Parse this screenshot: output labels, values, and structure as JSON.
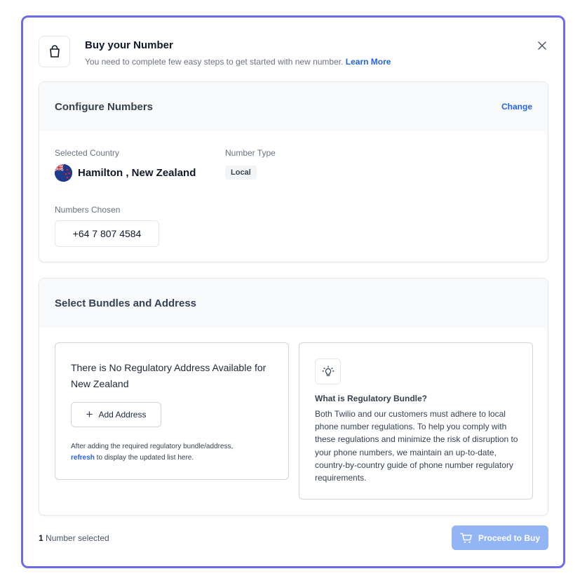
{
  "header": {
    "title": "Buy your Number",
    "subtitle": "You need to complete few easy steps to get started with new number.",
    "learn_more": "Learn More",
    "bag_icon": "shopping-bag-icon",
    "close_icon": "close-icon"
  },
  "configure": {
    "title": "Configure Numbers",
    "change_label": "Change",
    "country_label": "Selected Country",
    "country_value": "Hamilton , New Zealand",
    "type_label": "Number Type",
    "type_value": "Local",
    "numbers_label": "Numbers Chosen",
    "numbers": [
      "+64 7 807 4584"
    ]
  },
  "bundles": {
    "title": "Select Bundles and Address",
    "no_address_title": "There is No Regulatory Address Available for New Zealand",
    "add_button": "Add Address",
    "helper_before": "After adding the required regulatory bundle/address,",
    "helper_link": "refresh",
    "helper_after": " to display the updated list here.",
    "info_title": "What is Regulatory Bundle?",
    "info_body": "Both Twilio and our customers must adhere to local phone number regulations. To help you comply with these regulations and minimize the risk of disruption to your phone numbers, we maintain an up-to-date, country-by-country guide of phone number regulatory requirements.",
    "bulb_icon": "lightbulb-icon"
  },
  "footer": {
    "count": "1",
    "count_suffix": " Number selected",
    "buy_label": "Proceed to Buy",
    "cart_icon": "cart-icon"
  },
  "colors": {
    "accent": "#2563eb",
    "modal_border": "#6b6de8",
    "buy_button": "#93b4f5"
  }
}
